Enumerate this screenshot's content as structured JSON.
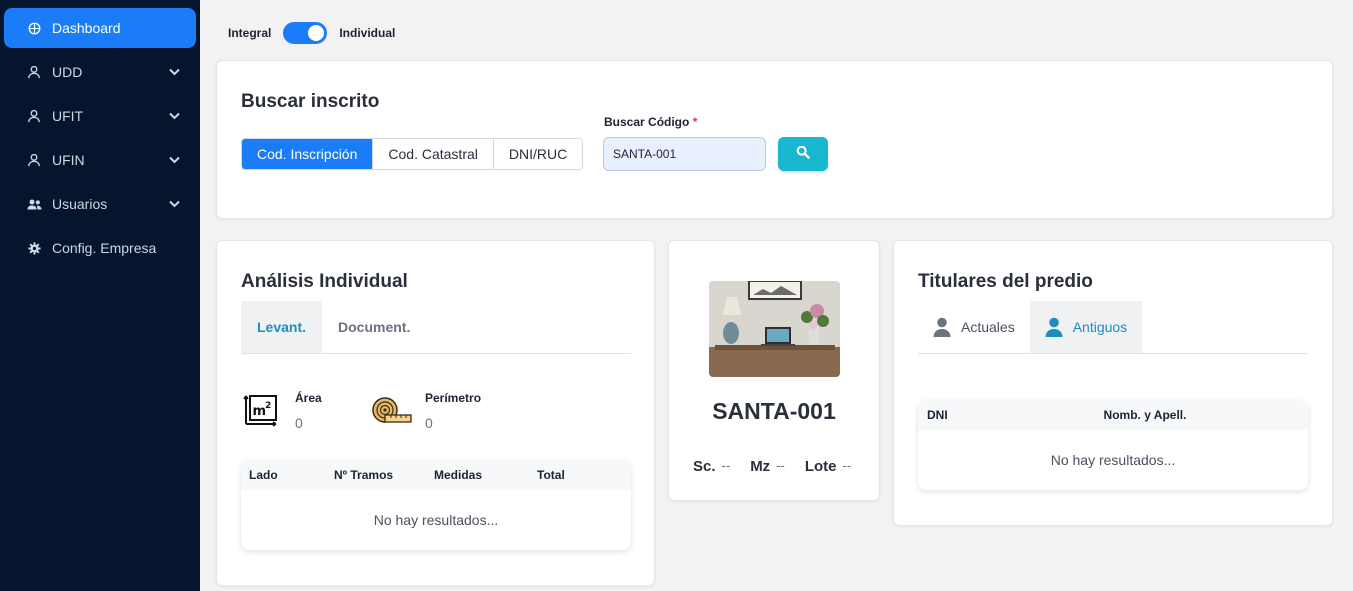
{
  "sidebar": {
    "items": [
      {
        "label": "Dashboard",
        "icon": "globe-icon"
      },
      {
        "label": "UDD",
        "icon": "user-icon"
      },
      {
        "label": "UFIT",
        "icon": "user-icon"
      },
      {
        "label": "UFIN",
        "icon": "user-icon"
      },
      {
        "label": "Usuarios",
        "icon": "users-icon"
      },
      {
        "label": "Config. Empresa",
        "icon": "gear-icon"
      }
    ]
  },
  "mode_toggle": {
    "left_label": "Integral",
    "right_label": "Individual",
    "state": "Individual"
  },
  "search": {
    "title": "Buscar inscrito",
    "options": [
      "Cod. Inscripción",
      "Cod. Catastral",
      "DNI/RUC"
    ],
    "selected": "Cod. Inscripción",
    "code_label": "Buscar Código",
    "required_mark": "*",
    "code_value": "SANTA-001"
  },
  "analysis": {
    "title": "Análisis Individual",
    "tabs": [
      "Levant.",
      "Document."
    ],
    "area_label": "Área",
    "area_value": "0",
    "perimetro_label": "Perímetro",
    "perimetro_value": "0",
    "table_headers": [
      "Lado",
      "Nº Tramos",
      "Medidas",
      "Total"
    ],
    "empty_text": "No hay resultados..."
  },
  "profile": {
    "code": "SANTA-001",
    "sc_label": "Sc.",
    "sc_value": "--",
    "mz_label": "Mz",
    "mz_value": "--",
    "lote_label": "Lote",
    "lote_value": "--"
  },
  "titulares": {
    "title": "Titulares del predio",
    "tabs": [
      "Actuales",
      "Antiguos"
    ],
    "active_tab": "Antiguos",
    "table_headers": [
      "DNI",
      "Nomb. y Apell."
    ],
    "empty_text": "No hay resultados..."
  },
  "colors": {
    "accent": "#1a7cf7",
    "sidebar_bg": "#04152d",
    "search_btn": "#17b7cf",
    "tab_active": "#1a8fbf"
  }
}
